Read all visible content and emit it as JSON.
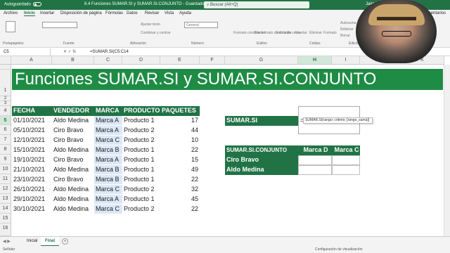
{
  "titlebar": {
    "autosave": "Autoguardado",
    "title": "6.4 Funciones SUMAR.SI y SUMAR.SI.CONJUNTO - Guardado",
    "search": "Buscar (Alt+Q)",
    "user": "Jairo Ve"
  },
  "tabs": [
    "Archivo",
    "Inicio",
    "Insertar",
    "Disposición de página",
    "Fórmulas",
    "Datos",
    "Revisar",
    "Vista",
    "Ayuda"
  ],
  "ribbon": {
    "groups": [
      "Portapapeles",
      "Fuente",
      "Alineación",
      "Número",
      "Estilos",
      "Celdas",
      "Edición"
    ],
    "wrap": "Ajustar texto",
    "merge": "Combinar y centrar",
    "general": "General",
    "cond_format": "Formato condicional",
    "table_format": "Dar formato como tabla",
    "cell_styles": "Estilos de celda",
    "insert": "Insertar",
    "delete": "Eliminar",
    "format": "Formato",
    "autosum": "Autosuma",
    "fill": "Rellenar",
    "clear": "Borrar",
    "comments": "Comentarios"
  },
  "formula_bar": {
    "name_box": "C5",
    "symbols": "✕  ✓  fx",
    "formula": "=SUMAR.SI(C5:C14"
  },
  "columns": [
    "A",
    "B",
    "C",
    "D",
    "E",
    "F",
    "G",
    "H",
    "I",
    "J",
    "K"
  ],
  "rows": [
    "1",
    "2",
    "3",
    "4",
    "5",
    "6",
    "7",
    "8",
    "9",
    "10",
    "11",
    "12",
    "13",
    "14",
    "15",
    "16"
  ],
  "banner": "Funciones SUMAR.SI y SUMAR.SI.CONJUNTO",
  "table": {
    "headers": [
      "FECHA",
      "VENDEDOR",
      "MARCA",
      "PRODUCTO",
      "PAQUETES"
    ],
    "rows": [
      [
        "01/10/2021",
        "Aldo Medina",
        "Marca A",
        "Producto 1",
        "17"
      ],
      [
        "05/10/2021",
        "Ciro Bravo",
        "Marca A",
        "Producto 2",
        "44"
      ],
      [
        "12/10/2021",
        "Ciro Bravo",
        "Marca C",
        "Producto 2",
        "10"
      ],
      [
        "15/10/2021",
        "Aldo Medina",
        "Marca B",
        "Producto 1",
        "22"
      ],
      [
        "19/10/2021",
        "Ciro Bravo",
        "Marca A",
        "Producto 1",
        "15"
      ],
      [
        "21/10/2021",
        "Aldo Medina",
        "Marca B",
        "Producto 1",
        "49"
      ],
      [
        "23/10/2021",
        "Ciro Bravo",
        "Marca B",
        "Producto 1",
        "22"
      ],
      [
        "26/10/2021",
        "Aldo Medina",
        "Marca C",
        "Producto 2",
        "32"
      ],
      [
        "29/10/2021",
        "Aldo Medina",
        "Marca A",
        "Producto 1",
        "45"
      ],
      [
        "30/10/2021",
        "Aldo Medina",
        "Marca C",
        "Producto 2",
        "22"
      ]
    ]
  },
  "sumar_si": {
    "label": "SUMAR.SI",
    "formula": "=SUMAR.SI(C5:C14",
    "tooltip": "SUMAR.SI(rango; criterio; [rango_suma])"
  },
  "conjunto": {
    "label": "SUMAR.SI.CONJUNTO",
    "cols": [
      "Marca D",
      "Marca C"
    ],
    "rows": [
      "Ciro Bravo",
      "Aldo Medina"
    ]
  },
  "sheets": [
    "Inicial",
    "Final"
  ],
  "status": {
    "mode": "Señalar",
    "display": "Configuración de visualización"
  }
}
